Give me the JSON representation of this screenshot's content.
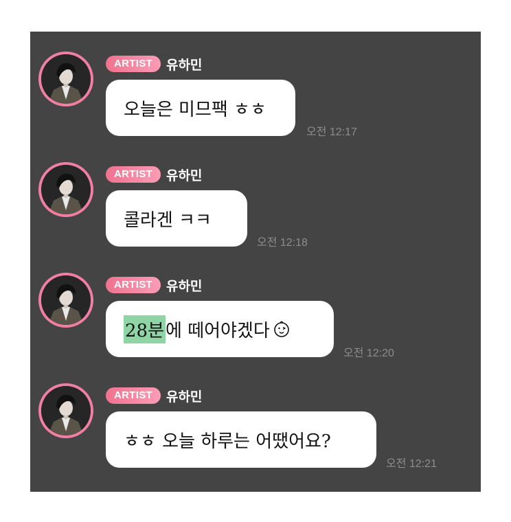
{
  "messages": [
    {
      "badge": "ARTIST",
      "sender": "유하민",
      "text": "오늘은 미므팩 ㅎㅎ",
      "time": "오전 12:17"
    },
    {
      "badge": "ARTIST",
      "sender": "유하민",
      "text": "콜라겐 ㅋㅋ",
      "time": "오전 12:18"
    },
    {
      "badge": "ARTIST",
      "sender": "유하민",
      "text_highlight": "28분",
      "text_rest": "에 떼어야겠다",
      "emoji": "smiley-face-icon",
      "time": "오전 12:20"
    },
    {
      "badge": "ARTIST",
      "sender": "유하민",
      "text": "ㅎㅎ 오늘 하루는 어땠어요?",
      "time": "오전 12:21"
    }
  ],
  "colors": {
    "background": "#444444",
    "badge_start": "#f0728f",
    "badge_end": "#fb9cb6",
    "avatar_ring": "#f17fa3",
    "bubble": "#ffffff",
    "timestamp": "#8d8d8d",
    "highlight": "#8fd4a4"
  }
}
